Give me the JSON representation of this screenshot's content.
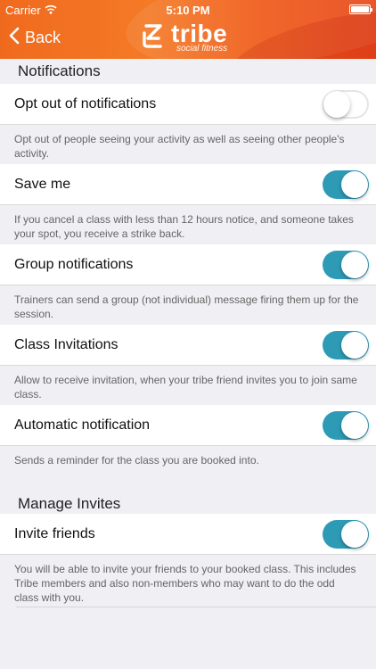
{
  "status": {
    "carrier": "Carrier",
    "time": "5:10 PM"
  },
  "nav": {
    "back_label": "Back",
    "logo_name": "tribe",
    "logo_sub": "social fitness"
  },
  "colors": {
    "header": "#f06a1e",
    "toggle_on": "#2d9bb5",
    "background": "#efeff4"
  },
  "sections": {
    "notifications": {
      "title": "Notifications",
      "items": [
        {
          "label": "Opt out of notifications",
          "enabled": false,
          "description": "Opt out of people seeing your activity as well as seeing other people's activity."
        },
        {
          "label": "Save me",
          "enabled": true,
          "description": "If you cancel a class with less than 12 hours notice, and someone takes your spot, you receive a strike back."
        },
        {
          "label": "Group notifications",
          "enabled": true,
          "description": "Trainers can send a group (not individual) message firing them up for the session."
        },
        {
          "label": "Class Invitations",
          "enabled": true,
          "description": "Allow to receive invitation, when your tribe friend invites you to join same class."
        },
        {
          "label": "Automatic notification",
          "enabled": true,
          "description": "Sends a reminder for the class you are booked into."
        }
      ]
    },
    "invites": {
      "title": "Manage Invites",
      "items": [
        {
          "label": "Invite friends",
          "enabled": true,
          "description": "You will be able to invite your friends to your booked class. This includes Tribe members and also non-members who may want to do the odd class with you."
        }
      ]
    }
  }
}
